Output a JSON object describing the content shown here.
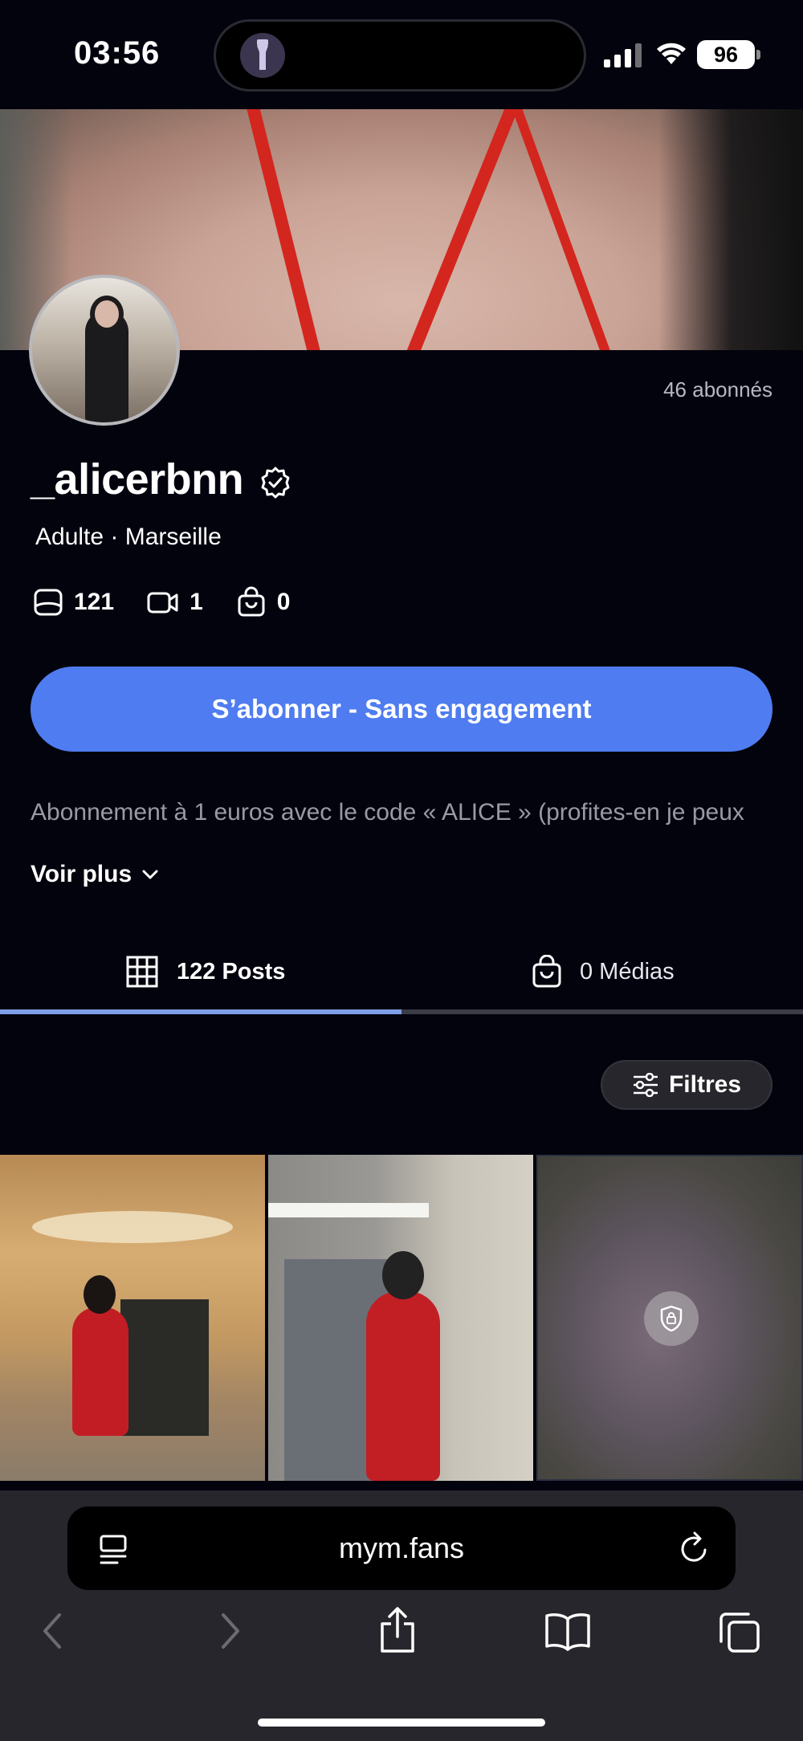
{
  "status_bar": {
    "time": "03:56",
    "battery": "96"
  },
  "profile": {
    "subscribers": "46 abonnés",
    "username": "_alicerbnn",
    "meta": "Adulte · Marseille",
    "stats": {
      "photos": "121",
      "videos": "1",
      "bag": "0"
    },
    "subscribe_label": "S’abonner - Sans engagement",
    "description": "Abonnement à 1 euros avec le code « ALICE » (profites-en je peux",
    "see_more": "Voir plus"
  },
  "tabs": [
    {
      "label": "122 Posts",
      "active": true
    },
    {
      "label": "0 Médias",
      "active": false
    }
  ],
  "filters_label": "Filtres",
  "browser": {
    "url": "mym.fans"
  },
  "colors": {
    "accent": "#4f7cf0",
    "background": "#03030e",
    "tab_indicator": "#7e9ee6"
  }
}
